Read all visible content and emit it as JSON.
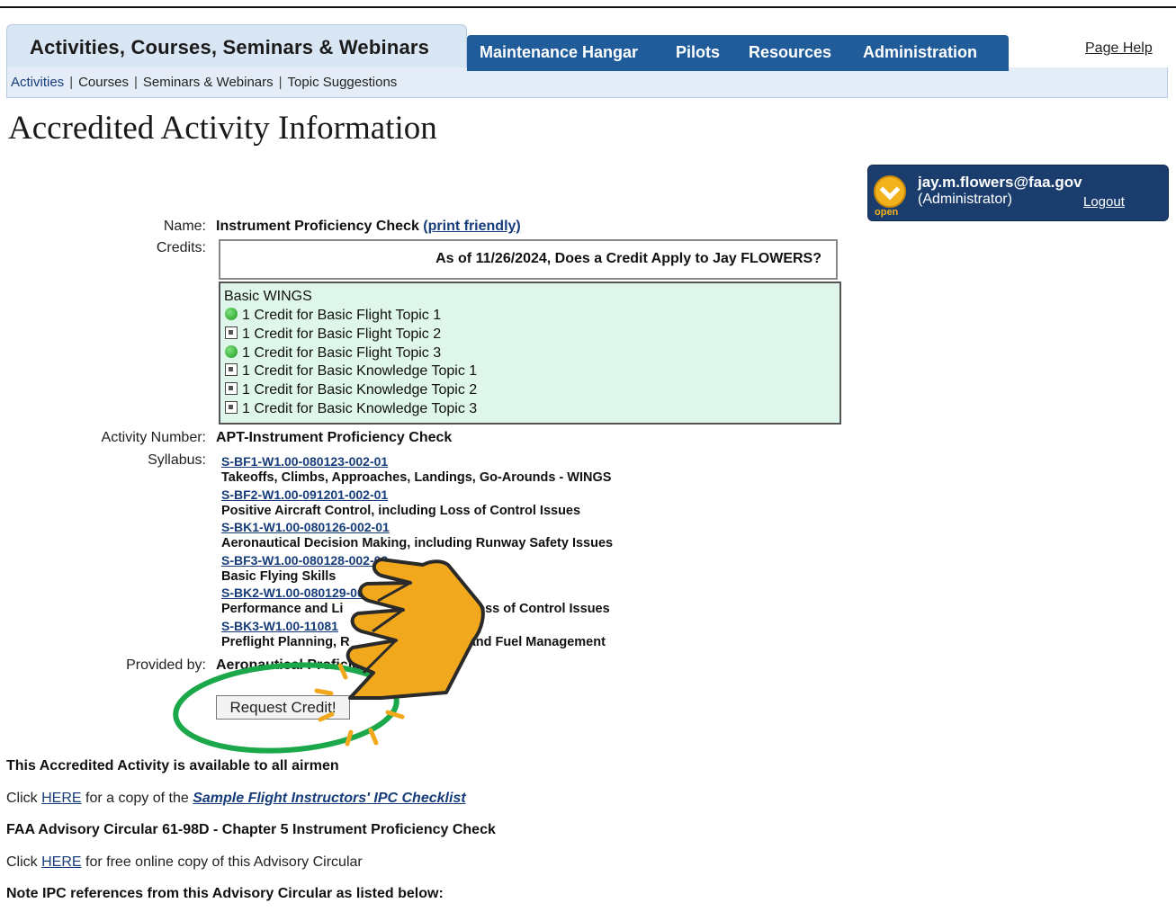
{
  "nav": {
    "active_tab": "Activities, Courses, Seminars & Webinars",
    "sub_links": [
      "Activities",
      "Courses",
      "Seminars & Webinars",
      "Topic Suggestions"
    ],
    "main_items": [
      "Maintenance Hangar",
      "Pilots",
      "Resources",
      "Administration"
    ],
    "page_help": "Page Help"
  },
  "page_title": "Accredited Activity Information",
  "user": {
    "email": "jay.m.flowers@faa.gov",
    "role": "(Administrator)",
    "logout": "Logout",
    "badge_label": "open"
  },
  "fields": {
    "name_label": "Name:",
    "name_value": "Instrument Proficiency Check",
    "print_friendly": "(print friendly)",
    "credits_label": "Credits:",
    "credit_question": "As of 11/26/2024, Does a Credit Apply to Jay FLOWERS?",
    "wings_header": "Basic WINGS",
    "wings_items": [
      {
        "text": "1 Credit for Basic Flight Topic 1",
        "status": "green-dot"
      },
      {
        "text": "1 Credit for Basic Flight Topic 2",
        "status": "box"
      },
      {
        "text": "1 Credit for Basic Flight Topic 3",
        "status": "green-dot"
      },
      {
        "text": "1 Credit for Basic Knowledge Topic 1",
        "status": "box"
      },
      {
        "text": "1 Credit for Basic Knowledge Topic 2",
        "status": "box"
      },
      {
        "text": "1 Credit for Basic Knowledge Topic 3",
        "status": "box"
      }
    ],
    "activity_number_label": "Activity Number:",
    "activity_number_value": "APT-Instrument Proficiency Check",
    "syllabus_label": "Syllabus:",
    "syllabus": [
      {
        "code": "S-BF1-W1.00-080123-002-01",
        "title": "Takeoffs, Climbs, Approaches, Landings, Go-Arounds - WINGS"
      },
      {
        "code": "S-BF2-W1.00-091201-002-01",
        "title": "Positive Aircraft Control, including Loss of Control Issues"
      },
      {
        "code": "S-BK1-W1.00-080126-002-01",
        "title": "Aeronautical Decision Making, including Runway Safety Issues"
      },
      {
        "code": "S-BF3-W1.00-080128-002-02",
        "title": "Basic Flying Skills"
      },
      {
        "code": "S-BK2-W1.00-080129-00",
        "title": "Performance and Li",
        "title_tail": "Loss of Control Issues"
      },
      {
        "code": "S-BK3-W1.00-11081",
        "title": "Preflight Planning, R",
        "title_tail": ", and Fuel Management"
      }
    ],
    "provided_by_label": "Provided by:",
    "provided_by_value": "Aeronautical Proficie"
  },
  "request_button": "Request Credit!",
  "footer": {
    "available": "This Accredited Activity is available to all airmen",
    "click1_prefix": "Click",
    "click1_link": "HERE",
    "click1_mid": "for a copy of the",
    "click1_doc": "Sample Flight Instructors' IPC Checklist",
    "ac_title": "FAA Advisory Circular 61-98D - Chapter 5 Instrument Proficiency Check",
    "click2_prefix": "Click",
    "click2_link": "HERE",
    "click2_rest": "for free online copy of this Advisory Circular",
    "note": "Note IPC references from this Advisory Circular as listed below:"
  },
  "colors": {
    "nav_blue": "#1f5c99",
    "subbar": "#e4edf7",
    "wings_bg": "#dff6ea",
    "userbox": "#1b3d6e",
    "annotation_circle": "#1aa84a",
    "annotation_hand": "#f2a81d"
  },
  "annotation": {
    "circle_icon": "green-highlight-circle",
    "hand_icon": "pointing-hand-icon"
  }
}
